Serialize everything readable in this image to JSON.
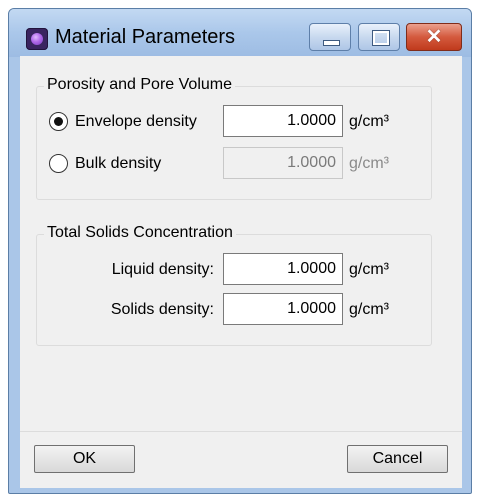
{
  "window": {
    "title": "Material Parameters",
    "close_glyph": "✕"
  },
  "porosity": {
    "title": "Porosity and Pore Volume",
    "options": [
      {
        "label": "Envelope density",
        "value": "1.0000",
        "unit": "g/cm³",
        "selected": true,
        "enabled": true
      },
      {
        "label": "Bulk density",
        "value": "1.0000",
        "unit": "g/cm³",
        "selected": false,
        "enabled": false
      }
    ]
  },
  "solids": {
    "title": "Total Solids Concentration",
    "liquid": {
      "label": "Liquid density:",
      "value": "1.0000",
      "unit": "g/cm³"
    },
    "solid": {
      "label": "Solids density:",
      "value": "1.0000",
      "unit": "g/cm³"
    }
  },
  "buttons": {
    "ok": "OK",
    "cancel": "Cancel"
  },
  "icons": {
    "app": "app-logo-icon",
    "minimize": "minimize-icon",
    "maximize": "maximize-icon",
    "close": "close-icon"
  },
  "colors": {
    "titlebar": "#aac7ea",
    "close_button": "#d45a3e",
    "client_background": "#f0f0f0"
  }
}
